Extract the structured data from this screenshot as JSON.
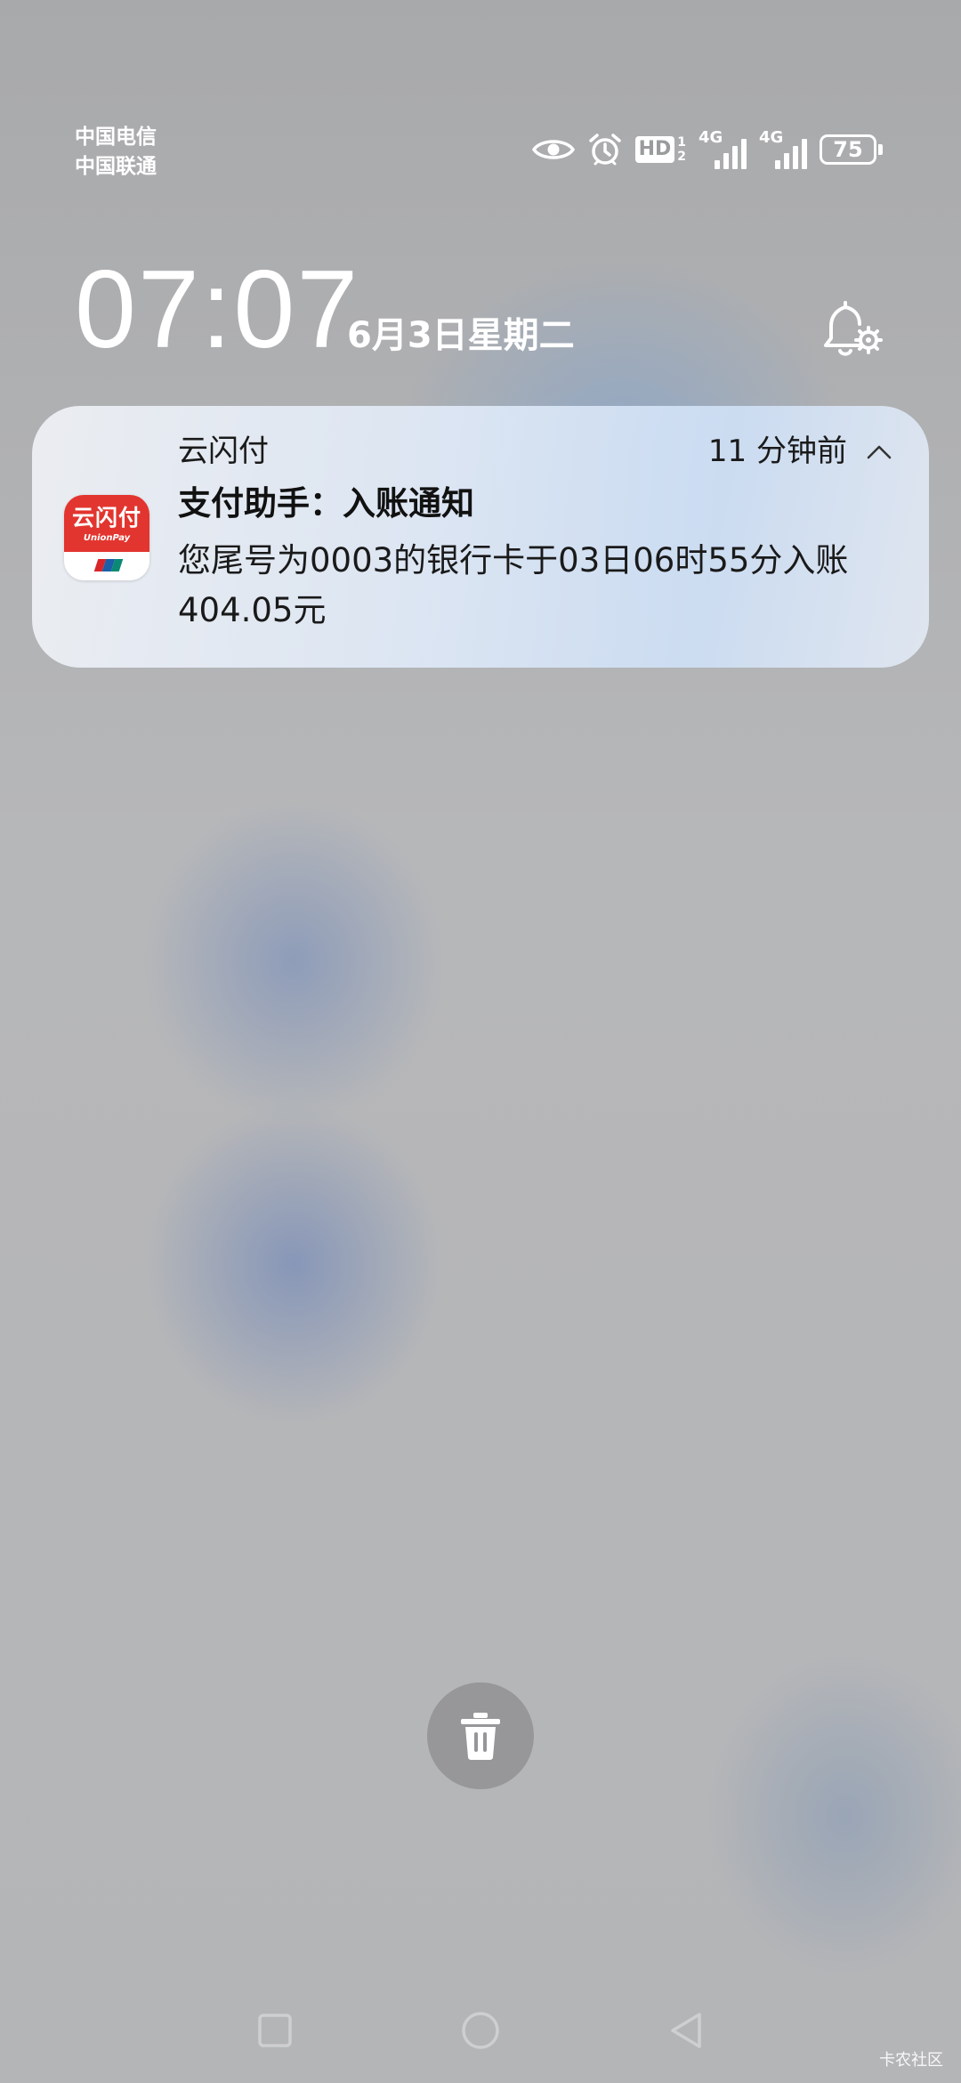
{
  "status_bar": {
    "carriers": [
      "中国电信",
      "中国联通"
    ],
    "hd": "HD",
    "hd_sub": [
      "1",
      "2"
    ],
    "network_1": "4G",
    "network_2": "4G",
    "battery": "75",
    "icons": [
      "eye-icon",
      "alarm-icon",
      "hd-icon",
      "signal-icon",
      "signal-icon",
      "battery-icon"
    ]
  },
  "lockscreen": {
    "time": "07:07",
    "date": "6月3日星期二"
  },
  "notification": {
    "app_name": "云闪付",
    "time_ago": "11 分钟前",
    "title": "支付助手：入账通知",
    "body": "您尾号为0003的银行卡于03日06时55分入账404.05元",
    "icon_text": "云闪付",
    "icon_subtext": "UnionPay",
    "icon_colors": {
      "top": "#e2352f",
      "flag": [
        "#d8252a",
        "#1a5fa8",
        "#0a8a74"
      ]
    }
  },
  "watermark": "卡农社区"
}
